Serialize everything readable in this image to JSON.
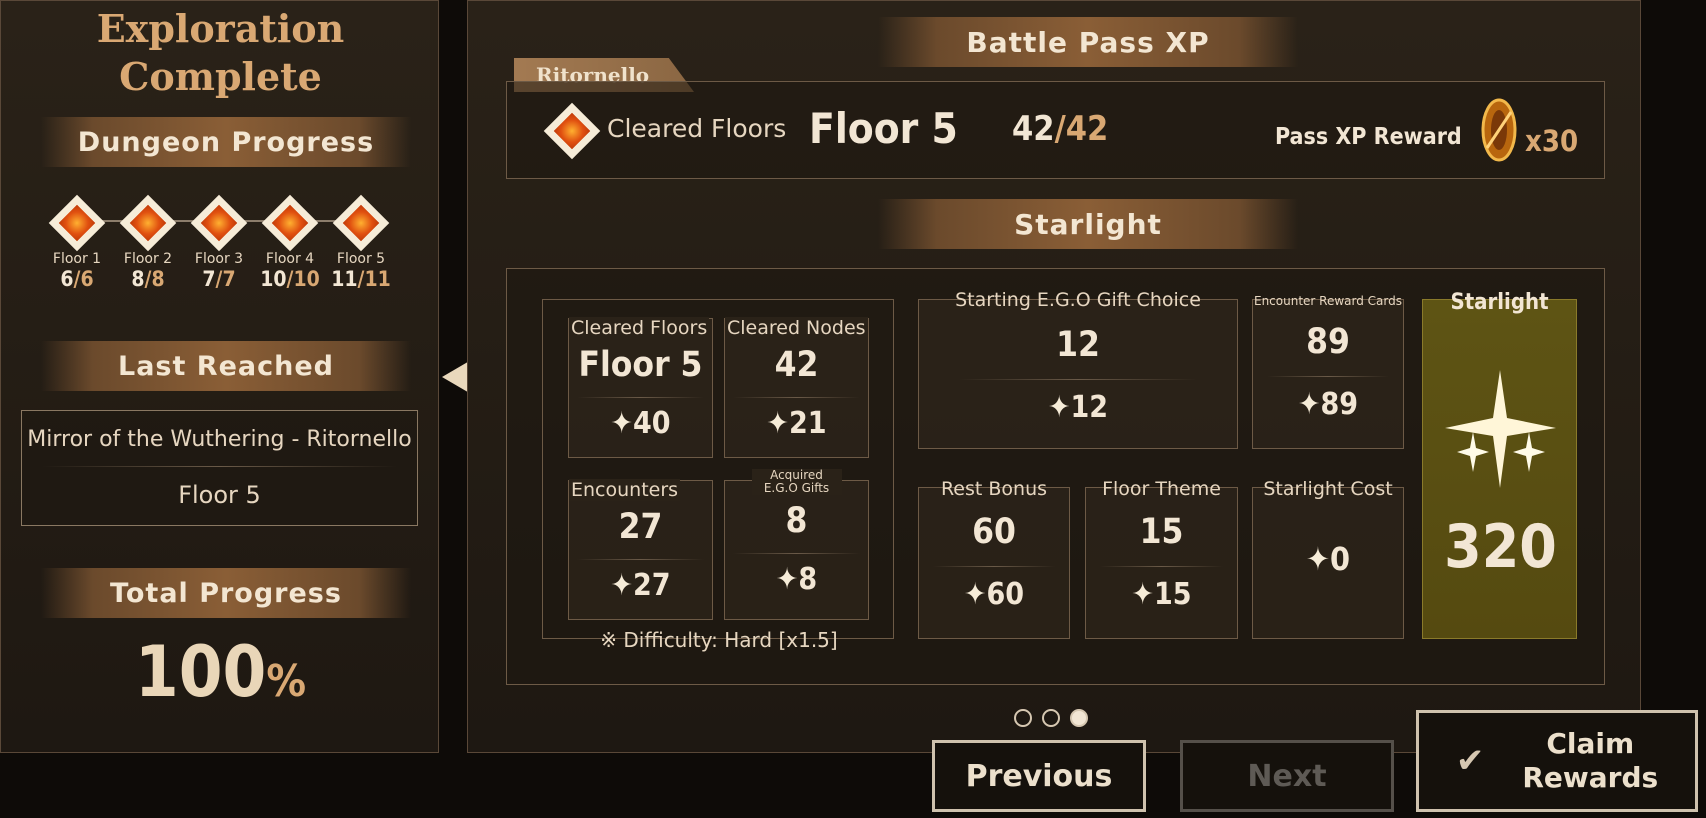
{
  "left": {
    "title_line1": "Exploration",
    "title_line2": "Complete",
    "dungeon_progress": "Dungeon Progress",
    "floors": [
      {
        "label": "Floor 1",
        "cur": "6",
        "total": "6"
      },
      {
        "label": "Floor 2",
        "cur": "8",
        "total": "8"
      },
      {
        "label": "Floor 3",
        "cur": "7",
        "total": "7"
      },
      {
        "label": "Floor 4",
        "cur": "10",
        "total": "10"
      },
      {
        "label": "Floor 5",
        "cur": "11",
        "total": "11"
      }
    ],
    "last_reached": "Last Reached",
    "dungeon_name": "Mirror of the Wuthering - Ritornello",
    "reached_floor": "Floor 5",
    "total_progress": "Total Progress",
    "total_value": "100",
    "percent": "%"
  },
  "right": {
    "battle_pass_title": "Battle Pass XP",
    "ritornello_tab": "Ritornello",
    "cleared_floors_label": "Cleared Floors",
    "floor_value": "Floor 5",
    "floor_count": "42",
    "floor_total": "42",
    "pass_xp_label": "Pass XP Reward",
    "pass_xp_mult": "x30",
    "starlight_title": "Starlight",
    "stats": {
      "cleared_floors": {
        "label": "Cleared Floors",
        "value": "Floor 5",
        "stars": "40"
      },
      "cleared_nodes": {
        "label": "Cleared Nodes",
        "value": "42",
        "stars": "21"
      },
      "encounters": {
        "label": "Encounters",
        "value": "27",
        "stars": "27"
      },
      "acquired_gifts": {
        "label": "Acquired E.G.O Gifts",
        "value": "8",
        "stars": "8"
      },
      "difficulty": "※ Difficulty: Hard [x1.5]",
      "starting_gift": {
        "label": "Starting E.G.O Gift Choice",
        "value": "12",
        "stars": "12"
      },
      "encounter_cards": {
        "label": "Encounter Reward Cards",
        "value": "89",
        "stars": "89"
      },
      "rest_bonus": {
        "label": "Rest Bonus",
        "value": "60",
        "stars": "60"
      },
      "floor_theme": {
        "label": "Floor Theme",
        "value": "15",
        "stars": "15"
      },
      "starlight_cost": {
        "label": "Starlight Cost",
        "stars": "0"
      },
      "starlight_total": {
        "label": "Starlight",
        "value": "320"
      }
    },
    "page_dots": {
      "count": 3,
      "active": 3
    }
  },
  "buttons": {
    "previous": "Previous",
    "next": "Next",
    "claim_line1": "Claim",
    "claim_line2": "Rewards"
  },
  "colors": {
    "accent_gold": "#d9a873",
    "starlight_box": "#5a4f12",
    "banner": "#8a5e36"
  }
}
